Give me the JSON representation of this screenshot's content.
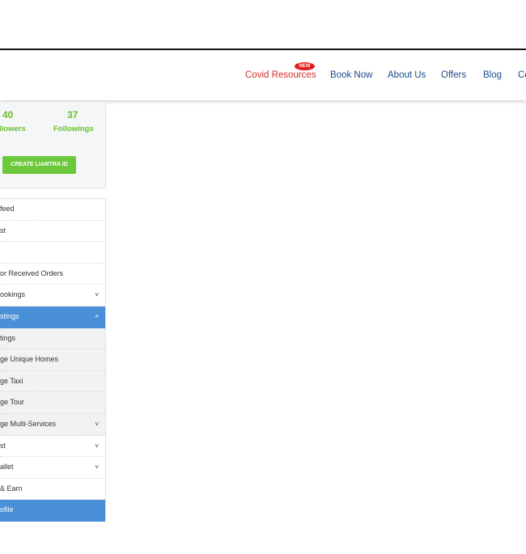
{
  "header": {
    "nav": [
      {
        "label": "Covid Resources",
        "color": "#d42a2a"
      },
      {
        "label": "Book Now"
      },
      {
        "label": "About Us"
      },
      {
        "label": "Offers"
      },
      {
        "label": "Blog"
      },
      {
        "label": "Co"
      }
    ],
    "new_badge": "NEW"
  },
  "profile": {
    "followers_count": "40",
    "followers_label": "llowers",
    "followings_count": "37",
    "followings_label": "Followings",
    "create_button": "CREATE LIAMTRA ID"
  },
  "menu": [
    {
      "label": "feed"
    },
    {
      "label": "st"
    },
    {
      "label": ""
    },
    {
      "label": "or Received Orders"
    },
    {
      "label": "ookings",
      "chevron": "chevron-down-icon"
    },
    {
      "label": "stings",
      "chevron": "chevron-up-icon",
      "active": true
    },
    {
      "label": "tings",
      "sub": true
    },
    {
      "label": "ge Unique Homes",
      "sub": true
    },
    {
      "label": "ge Taxi",
      "sub": true
    },
    {
      "label": "ge Tour",
      "sub": true
    },
    {
      "label": "ge Multi-Services",
      "chevron": "chevron-down-icon",
      "sub": true
    },
    {
      "label": "st",
      "chevron": "chevron-down-icon"
    },
    {
      "label": "allet",
      "chevron": "chevron-down-icon"
    },
    {
      "label": "& Earn"
    },
    {
      "label": "ofile",
      "active": true
    }
  ],
  "colors": {
    "accent_green": "#6bbf2e",
    "active_blue": "#4a90d9",
    "nav_blue": "#1a4a8a"
  }
}
